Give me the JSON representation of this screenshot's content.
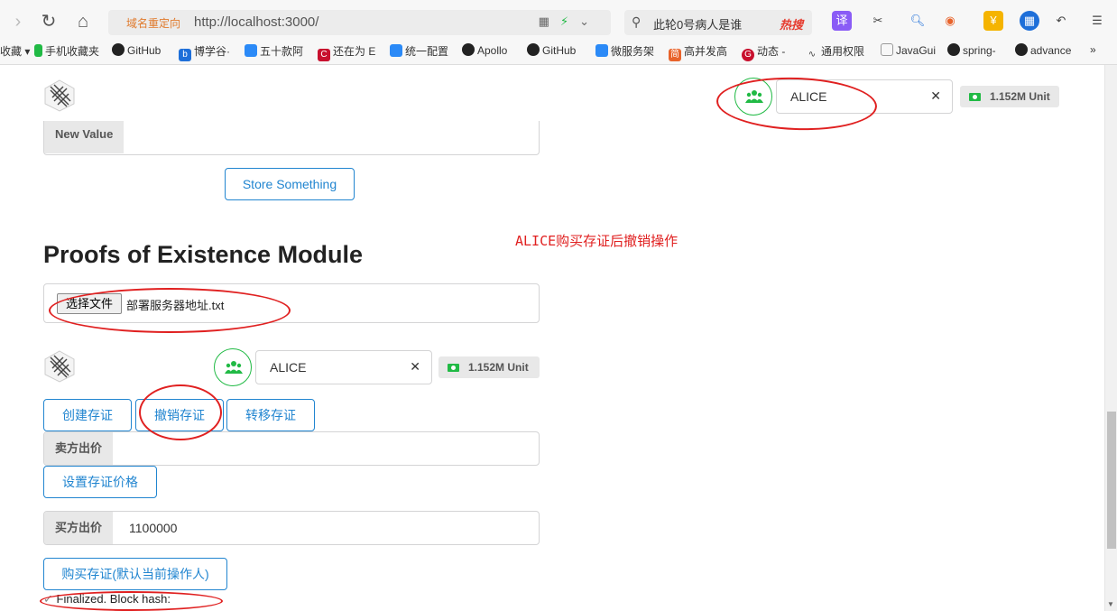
{
  "browser": {
    "redirect_tag": "域名重定向",
    "url": "http://localhost:3000/",
    "search_text": "此轮0号病人是谁",
    "hot_search": "热搜",
    "bookmarks": [
      "收藏 ▾",
      "手机收藏夹",
      "GitHub",
      "博学谷·",
      "五十款阿",
      "还在为 E",
      "统一配置",
      "Apollo",
      "GitHub",
      "微服务架",
      "高并发高",
      "动态 -",
      "通用权限",
      "JavaGui",
      "spring-",
      "advance",
      "»"
    ]
  },
  "top_account": {
    "name": "ALICE",
    "balance": "1.152M Unit"
  },
  "storage": {
    "new_value_label": "New Value",
    "store_button": "Store Something"
  },
  "annotation": "ALICE购买存证后撤销操作",
  "poe": {
    "title": "Proofs of Existence Module",
    "file_button": "选择文件",
    "file_name": "部署服务器地址.txt",
    "account_name": "ALICE",
    "account_balance": "1.152M Unit",
    "create_button": "创建存证",
    "revoke_button": "撤销存证",
    "transfer_button": "转移存证",
    "seller_price_label": "卖方出价",
    "seller_price_value": "",
    "set_price_button": "设置存证价格",
    "buyer_price_label": "买方出价",
    "buyer_price_value": "1100000",
    "buy_button": "购买存证(默认当前操作人)",
    "status_text": "Finalized. Block hash:"
  },
  "colors": {
    "accent": "#2185d0",
    "account_green": "#21ba45",
    "annotation_red": "#e02020"
  }
}
